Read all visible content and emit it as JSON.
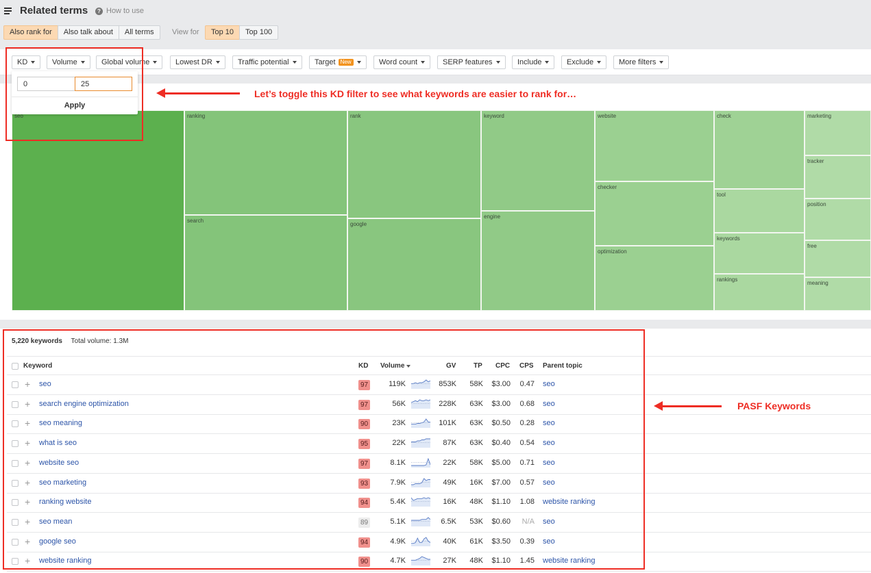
{
  "header": {
    "title": "Related terms",
    "help_label": "How to use",
    "help_icon": "question-circle-icon",
    "menu_icon": "hamburger-icon"
  },
  "mode_tabs": [
    {
      "label": "Also rank for",
      "active": true
    },
    {
      "label": "Also talk about",
      "active": false
    },
    {
      "label": "All terms",
      "active": false
    }
  ],
  "view_for": {
    "label": "View for",
    "options": [
      {
        "label": "Top 10",
        "active": true
      },
      {
        "label": "Top 100",
        "active": false
      }
    ]
  },
  "filters": [
    {
      "label": "KD"
    },
    {
      "label": "Volume"
    },
    {
      "label": "Global volume"
    },
    {
      "label": "Lowest DR"
    },
    {
      "label": "Traffic potential"
    },
    {
      "label": "Target",
      "badge": "New"
    },
    {
      "label": "Word count"
    },
    {
      "label": "SERP features"
    },
    {
      "label": "Include"
    },
    {
      "label": "Exclude"
    },
    {
      "label": "More filters"
    }
  ],
  "kd_dropdown": {
    "min_value": "0",
    "max_value": "25",
    "apply_label": "Apply"
  },
  "treemap": {
    "terms": [
      "seo",
      "ranking",
      "search",
      "rank",
      "google",
      "keyword",
      "engine",
      "website",
      "checker",
      "optimization",
      "check",
      "tool",
      "keywords",
      "rankings",
      "marketing",
      "tracker",
      "position",
      "free",
      "meaning"
    ],
    "colors": {
      "seo": "#5cb04e",
      "col2": "#84c47a",
      "col3": "#89c67f",
      "col4": "#91ca87",
      "col5": "#9bd091",
      "col6a": "#9fd295",
      "col6b": "#aad8a0",
      "col7": "#b0dba7"
    }
  },
  "table": {
    "keyword_count": "5,220 keywords",
    "total_volume": "Total volume: 1.3M",
    "columns": [
      "Keyword",
      "KD",
      "Volume",
      "GV",
      "TP",
      "CPC",
      "CPS",
      "Parent topic"
    ],
    "sort_column": "Volume",
    "rows": [
      {
        "keyword": "seo",
        "kd": "97",
        "kd_level": "hard",
        "volume": "119K",
        "gv": "853K",
        "tp": "58K",
        "cpc": "$3.00",
        "cps": "0.47",
        "parent": "seo",
        "trend": [
          5,
          5,
          6,
          5,
          6,
          6,
          7,
          9,
          7,
          8
        ]
      },
      {
        "keyword": "search engine optimization",
        "kd": "97",
        "kd_level": "hard",
        "volume": "56K",
        "gv": "228K",
        "tp": "63K",
        "cpc": "$3.00",
        "cps": "0.68",
        "parent": "seo",
        "trend": [
          6,
          7,
          8,
          7,
          9,
          8,
          8,
          9,
          8,
          9
        ]
      },
      {
        "keyword": "seo meaning",
        "kd": "90",
        "kd_level": "hard",
        "volume": "23K",
        "gv": "101K",
        "tp": "63K",
        "cpc": "$0.50",
        "cps": "0.28",
        "parent": "seo",
        "trend": [
          4,
          4,
          4,
          5,
          5,
          6,
          7,
          11,
          7,
          7
        ]
      },
      {
        "keyword": "what is seo",
        "kd": "95",
        "kd_level": "hard",
        "volume": "22K",
        "gv": "87K",
        "tp": "63K",
        "cpc": "$0.40",
        "cps": "0.54",
        "parent": "seo",
        "trend": [
          5,
          5,
          5,
          6,
          6,
          7,
          7,
          8,
          8,
          8
        ]
      },
      {
        "keyword": "website seo",
        "kd": "97",
        "kd_level": "hard",
        "volume": "8.1K",
        "gv": "22K",
        "tp": "58K",
        "cpc": "$5.00",
        "cps": "0.71",
        "parent": "seo",
        "trend": [
          2,
          2,
          2,
          2,
          2,
          2,
          2,
          3,
          12,
          3
        ]
      },
      {
        "keyword": "seo marketing",
        "kd": "93",
        "kd_level": "hard",
        "volume": "7.9K",
        "gv": "49K",
        "tp": "16K",
        "cpc": "$7.00",
        "cps": "0.57",
        "parent": "seo",
        "trend": [
          2,
          2,
          3,
          3,
          3,
          4,
          8,
          6,
          7,
          7
        ]
      },
      {
        "keyword": "ranking website",
        "kd": "94",
        "kd_level": "hard",
        "volume": "5.4K",
        "gv": "16K",
        "tp": "48K",
        "cpc": "$1.10",
        "cps": "1.08",
        "parent": "website ranking",
        "trend": [
          9,
          6,
          7,
          8,
          8,
          8,
          9,
          8,
          9,
          8
        ]
      },
      {
        "keyword": "seo mean",
        "kd": "89",
        "kd_level": "na",
        "volume": "5.1K",
        "gv": "6.5K",
        "tp": "53K",
        "cpc": "$0.60",
        "cps": "N/A",
        "parent": "seo",
        "trend": [
          6,
          6,
          6,
          6,
          6,
          7,
          7,
          7,
          9,
          7
        ]
      },
      {
        "keyword": "google seo",
        "kd": "94",
        "kd_level": "hard",
        "volume": "4.9K",
        "gv": "40K",
        "tp": "61K",
        "cpc": "$3.50",
        "cps": "0.39",
        "parent": "seo",
        "trend": [
          3,
          3,
          4,
          10,
          4,
          4,
          9,
          11,
          6,
          4
        ]
      },
      {
        "keyword": "website ranking",
        "kd": "90",
        "kd_level": "hard",
        "volume": "4.7K",
        "gv": "27K",
        "tp": "48K",
        "cpc": "$1.10",
        "cps": "1.45",
        "parent": "website ranking",
        "trend": [
          5,
          5,
          5,
          6,
          7,
          9,
          8,
          7,
          6,
          6
        ]
      }
    ]
  },
  "annotations": {
    "kd_note": "Let’s toggle this KD filter to see what keywords are easier to rank for…",
    "pasf_note": "PASF Keywords",
    "color": "#ee2d24"
  },
  "colors": {
    "accent_active": "#fcd9b3",
    "link": "#2c54a8",
    "kd_hard": "#f0908c",
    "kd_na": "#ececec"
  }
}
